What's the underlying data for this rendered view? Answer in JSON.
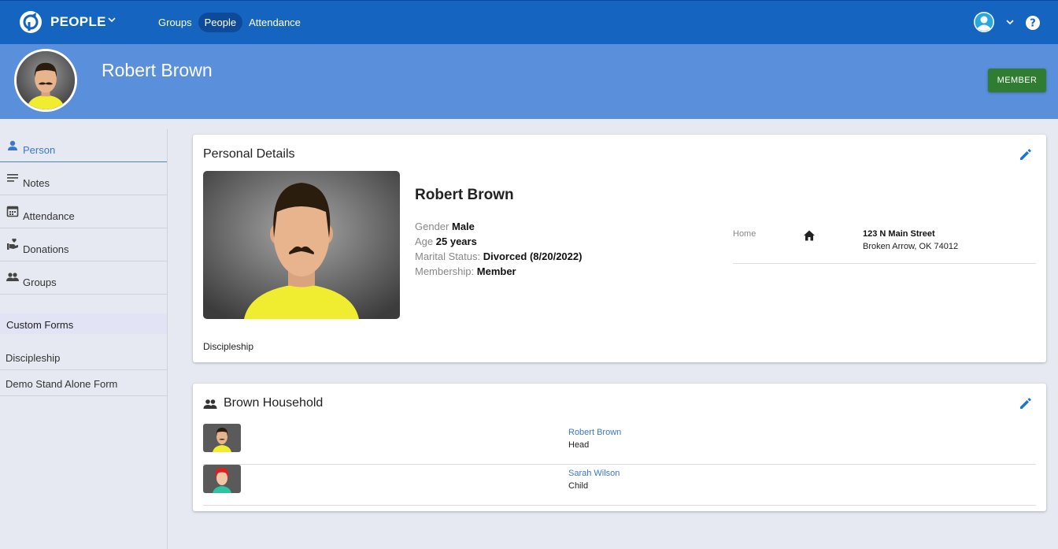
{
  "topnav": {
    "app_name": "PEOPLE",
    "items": [
      {
        "label": "Groups",
        "active": false
      },
      {
        "label": "People",
        "active": true
      },
      {
        "label": "Attendance",
        "active": false
      }
    ],
    "colors": {
      "bar": "#1565c0",
      "active_pill": "#0d4a9a"
    }
  },
  "header": {
    "name": "Robert Brown",
    "badge": "MEMBER",
    "colors": {
      "banner": "#5a8fdb",
      "badge": "#2e7d32"
    }
  },
  "sidebar": {
    "tabs": [
      {
        "label": "Person",
        "icon": "person-icon",
        "active": true
      },
      {
        "label": "Notes",
        "icon": "notes-icon",
        "active": false
      },
      {
        "label": "Attendance",
        "icon": "calendar-icon",
        "active": false
      },
      {
        "label": "Donations",
        "icon": "donation-icon",
        "active": false
      },
      {
        "label": "Groups",
        "icon": "groups-icon",
        "active": false
      }
    ],
    "custom_forms_header": "Custom Forms",
    "forms": [
      "Discipleship",
      "Demo Stand Alone Form"
    ]
  },
  "personal_details": {
    "title": "Personal Details",
    "name": "Robert Brown",
    "fields": [
      {
        "label": "Gender",
        "value": "Male"
      },
      {
        "label": "Age",
        "value": "25 years"
      },
      {
        "label": "Marital Status:",
        "value": "Divorced (8/20/2022)"
      },
      {
        "label": "Membership:",
        "value": "Member"
      }
    ],
    "address": {
      "label": "Home",
      "line1": "123 N Main Street",
      "line2": "Broken Arrow, OK 74012"
    },
    "form_tag": "Discipleship"
  },
  "household": {
    "title": "Brown Household",
    "members": [
      {
        "name": "Robert Brown",
        "role": "Head",
        "avatar": "man-avatar"
      },
      {
        "name": "Sarah Wilson",
        "role": "Child",
        "avatar": "girl-avatar"
      }
    ]
  }
}
